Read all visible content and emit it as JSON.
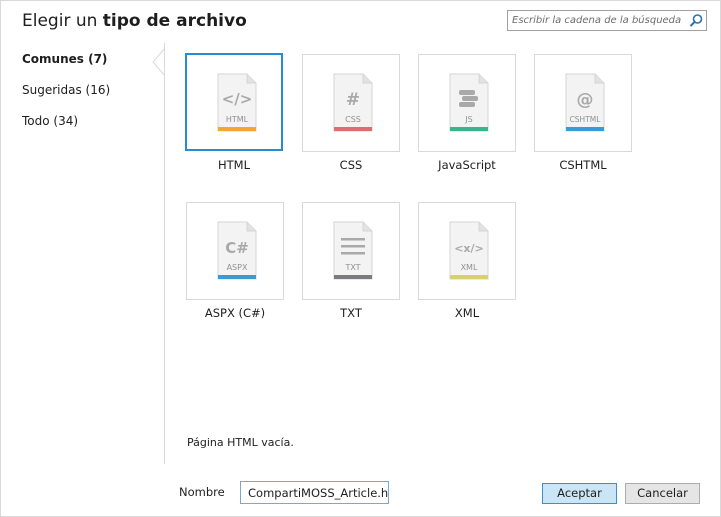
{
  "dialog": {
    "title_prefix": "Elegir un ",
    "title_bold": "tipo de archivo"
  },
  "search": {
    "placeholder": "Escribir la cadena de la búsqueda"
  },
  "categories": [
    {
      "label": "Comunes (7)",
      "active": true
    },
    {
      "label": "Sugeridas (16)",
      "active": false
    },
    {
      "label": "Todo (34)",
      "active": false
    }
  ],
  "file_types": [
    {
      "label": "HTML",
      "icon_text": "HTML",
      "glyph": "</>",
      "accent": "#f0a830",
      "selected": true
    },
    {
      "label": "CSS",
      "icon_text": "CSS",
      "glyph": "#",
      "accent": "#e06c6c",
      "selected": false
    },
    {
      "label": "JavaScript",
      "icon_text": "JS",
      "glyph": "stack",
      "accent": "#3ab48c",
      "selected": false
    },
    {
      "label": "CSHTML",
      "icon_text": "CSHTML",
      "glyph": "@",
      "accent": "#3a9ad4",
      "selected": false
    },
    {
      "label": "ASPX (C#)",
      "icon_text": "ASPX",
      "glyph": "C#",
      "accent": "#3a9ad4",
      "selected": false
    },
    {
      "label": "TXT",
      "icon_text": "TXT",
      "glyph": "lines",
      "accent": "#7a7a80",
      "selected": false
    },
    {
      "label": "XML",
      "icon_text": "XML",
      "glyph": "<x/>",
      "accent": "#d8d070",
      "selected": false
    }
  ],
  "description": "Página HTML vacía.",
  "name_field": {
    "label": "Nombre",
    "value": "CompartiMOSS_Article.ht"
  },
  "buttons": {
    "ok": "Aceptar",
    "cancel": "Cancelar"
  }
}
